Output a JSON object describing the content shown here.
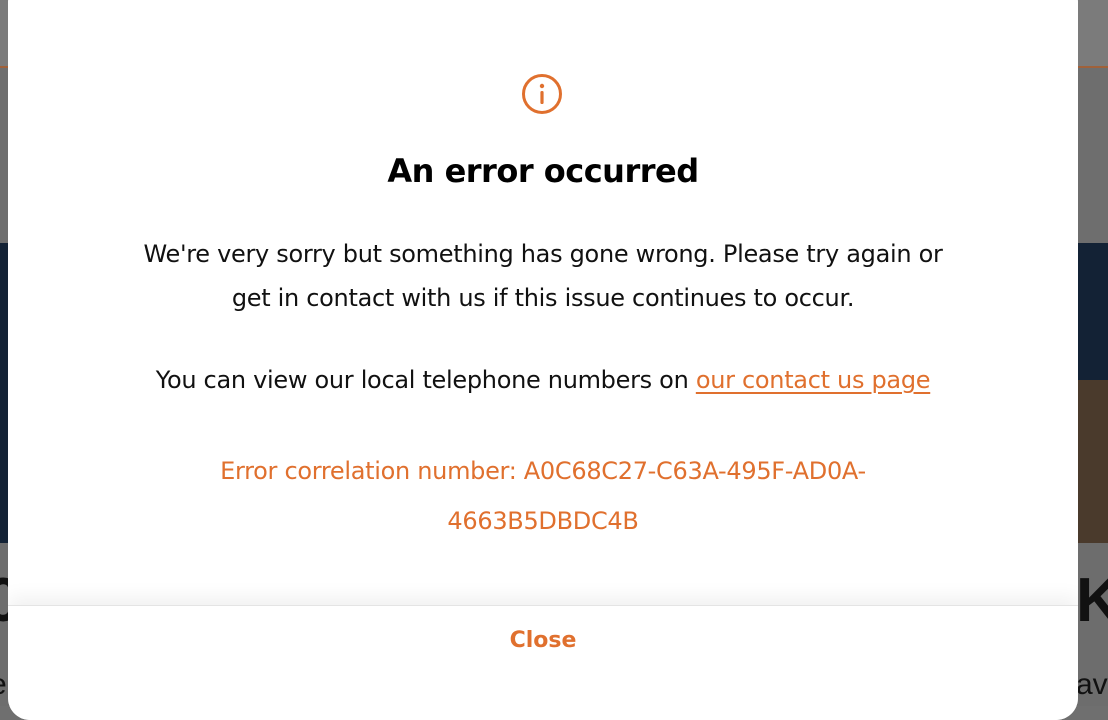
{
  "modal": {
    "icon": "info-circle-icon",
    "title": "An error occurred",
    "message_line1": "We're very sorry but something has gone wrong. Please try again or",
    "message_line2": "get in contact with us if this issue continues to occur.",
    "contact_prefix": "You can view our local telephone numbers on ",
    "contact_link": "our contact us page",
    "correlation_line1": "Error correlation number: A0C68C27-C63A-495F-AD0A-",
    "correlation_line2": "4663B5DBDC4B",
    "close_label": "Close"
  },
  "colors": {
    "accent": "#e0702e",
    "overlay": "#6f6f6f",
    "banner": "#132235"
  }
}
